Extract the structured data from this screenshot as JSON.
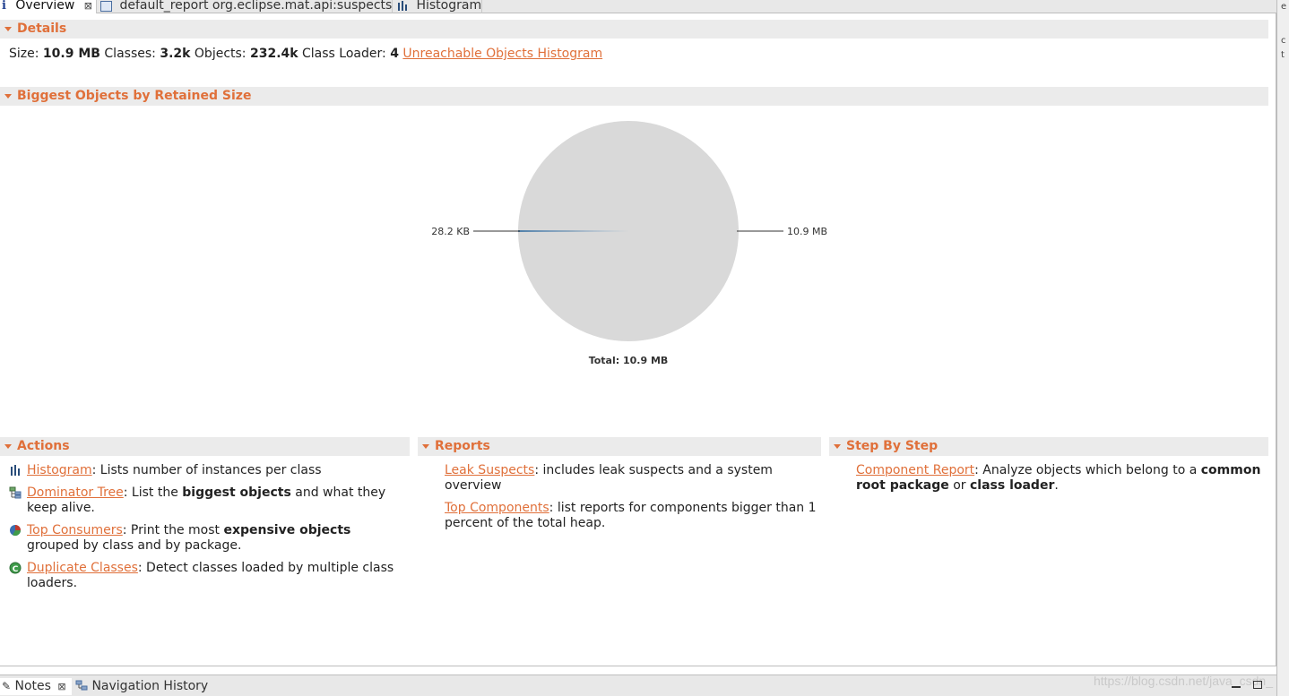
{
  "tabs": [
    {
      "label": "Overview",
      "icon": "info-icon",
      "active": true
    },
    {
      "label": "default_report  org.eclipse.mat.api:suspects",
      "icon": "report-icon"
    },
    {
      "label": "Histogram",
      "icon": "histogram-icon"
    }
  ],
  "details": {
    "title": "Details",
    "size_label": "Size:",
    "size_value": "10.9 MB",
    "classes_label": "Classes:",
    "classes_value": "3.2k",
    "objects_label": "Objects:",
    "objects_value": "232.4k",
    "loader_label": "Class Loader:",
    "loader_value": "4",
    "link": "Unreachable Objects Histogram"
  },
  "biggest": {
    "title": "Biggest Objects by Retained Size"
  },
  "chart_data": {
    "type": "pie",
    "slices": [
      {
        "label": "10.9 MB",
        "value": 10900,
        "color": "#d9d9d9"
      },
      {
        "label": "28.2 KB",
        "value": 28.2,
        "color": "#4f7ea8"
      }
    ],
    "total_label": "Total: 10.9 MB"
  },
  "actions": {
    "title": "Actions",
    "items": [
      {
        "icon": "histogram-icon",
        "link": "Histogram",
        "pre": ": Lists number of instances per class",
        "bold": "",
        "post": ""
      },
      {
        "icon": "dominator-tree-icon",
        "link": "Dominator Tree",
        "pre": ": List the ",
        "bold": "biggest objects",
        "post": " and what they keep alive."
      },
      {
        "icon": "top-consumers-icon",
        "link": "Top Consumers",
        "pre": ": Print the most ",
        "bold": "expensive objects",
        "post": " grouped by class and by package."
      },
      {
        "icon": "duplicate-classes-icon",
        "link": "Duplicate Classes",
        "pre": ": Detect classes loaded by multiple class loaders.",
        "bold": "",
        "post": ""
      }
    ]
  },
  "reports": {
    "title": "Reports",
    "items": [
      {
        "link": "Leak Suspects",
        "text": ": includes leak suspects and a system overview"
      },
      {
        "link": "Top Components",
        "text": ": list reports for components bigger than 1 percent of the total heap."
      }
    ]
  },
  "stepbystep": {
    "title": "Step By Step",
    "link": "Component Report",
    "pre": ": Analyze objects which belong to a ",
    "bold1": "common root package",
    "mid": " or ",
    "bold2": "class loader",
    "post": "."
  },
  "bottom": {
    "notes_label": "Notes",
    "nav_label": "Navigation History",
    "watermark": "https://blog.csdn.net/java_csdn_"
  },
  "colors": {
    "accent": "#e0703a",
    "header_bg": "#ebebeb"
  }
}
